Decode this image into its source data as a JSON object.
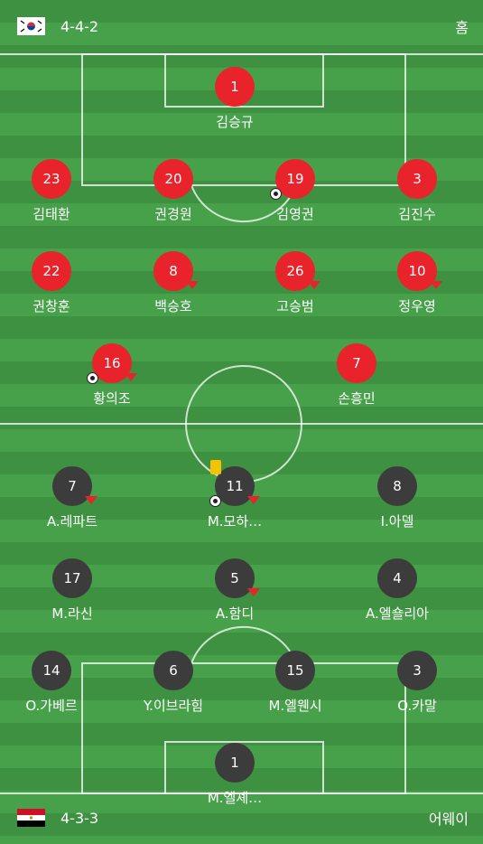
{
  "home": {
    "formation": "4-4-2",
    "side_label": "홈",
    "flag": "south-korea-flag-icon",
    "players": [
      {
        "number": "1",
        "name": "김승규"
      },
      {
        "number": "23",
        "name": "김태환"
      },
      {
        "number": "20",
        "name": "권경원"
      },
      {
        "number": "19",
        "name": "김영권"
      },
      {
        "number": "3",
        "name": "김진수"
      },
      {
        "number": "22",
        "name": "권창훈"
      },
      {
        "number": "8",
        "name": "백승호"
      },
      {
        "number": "26",
        "name": "고승범"
      },
      {
        "number": "10",
        "name": "정우영"
      },
      {
        "number": "16",
        "name": "황의조"
      },
      {
        "number": "7",
        "name": "손흥민"
      }
    ]
  },
  "away": {
    "formation": "4-3-3",
    "side_label": "어웨이",
    "flag": "egypt-flag-icon",
    "players": [
      {
        "number": "7",
        "name": "A.레파트"
      },
      {
        "number": "11",
        "name": "M.모하…"
      },
      {
        "number": "8",
        "name": "I.아델"
      },
      {
        "number": "17",
        "name": "M.라신"
      },
      {
        "number": "5",
        "name": "A.함디"
      },
      {
        "number": "4",
        "name": "A.엘숄리아"
      },
      {
        "number": "14",
        "name": "O.가베르"
      },
      {
        "number": "6",
        "name": "Y.이브라힘"
      },
      {
        "number": "15",
        "name": "M.엘웬시"
      },
      {
        "number": "3",
        "name": "O.카말"
      },
      {
        "number": "1",
        "name": "M.엘셰…"
      }
    ]
  },
  "colors": {
    "home_disc": "#e8232b",
    "away_disc": "#3c3c3c",
    "pitch": "#3d9140"
  }
}
